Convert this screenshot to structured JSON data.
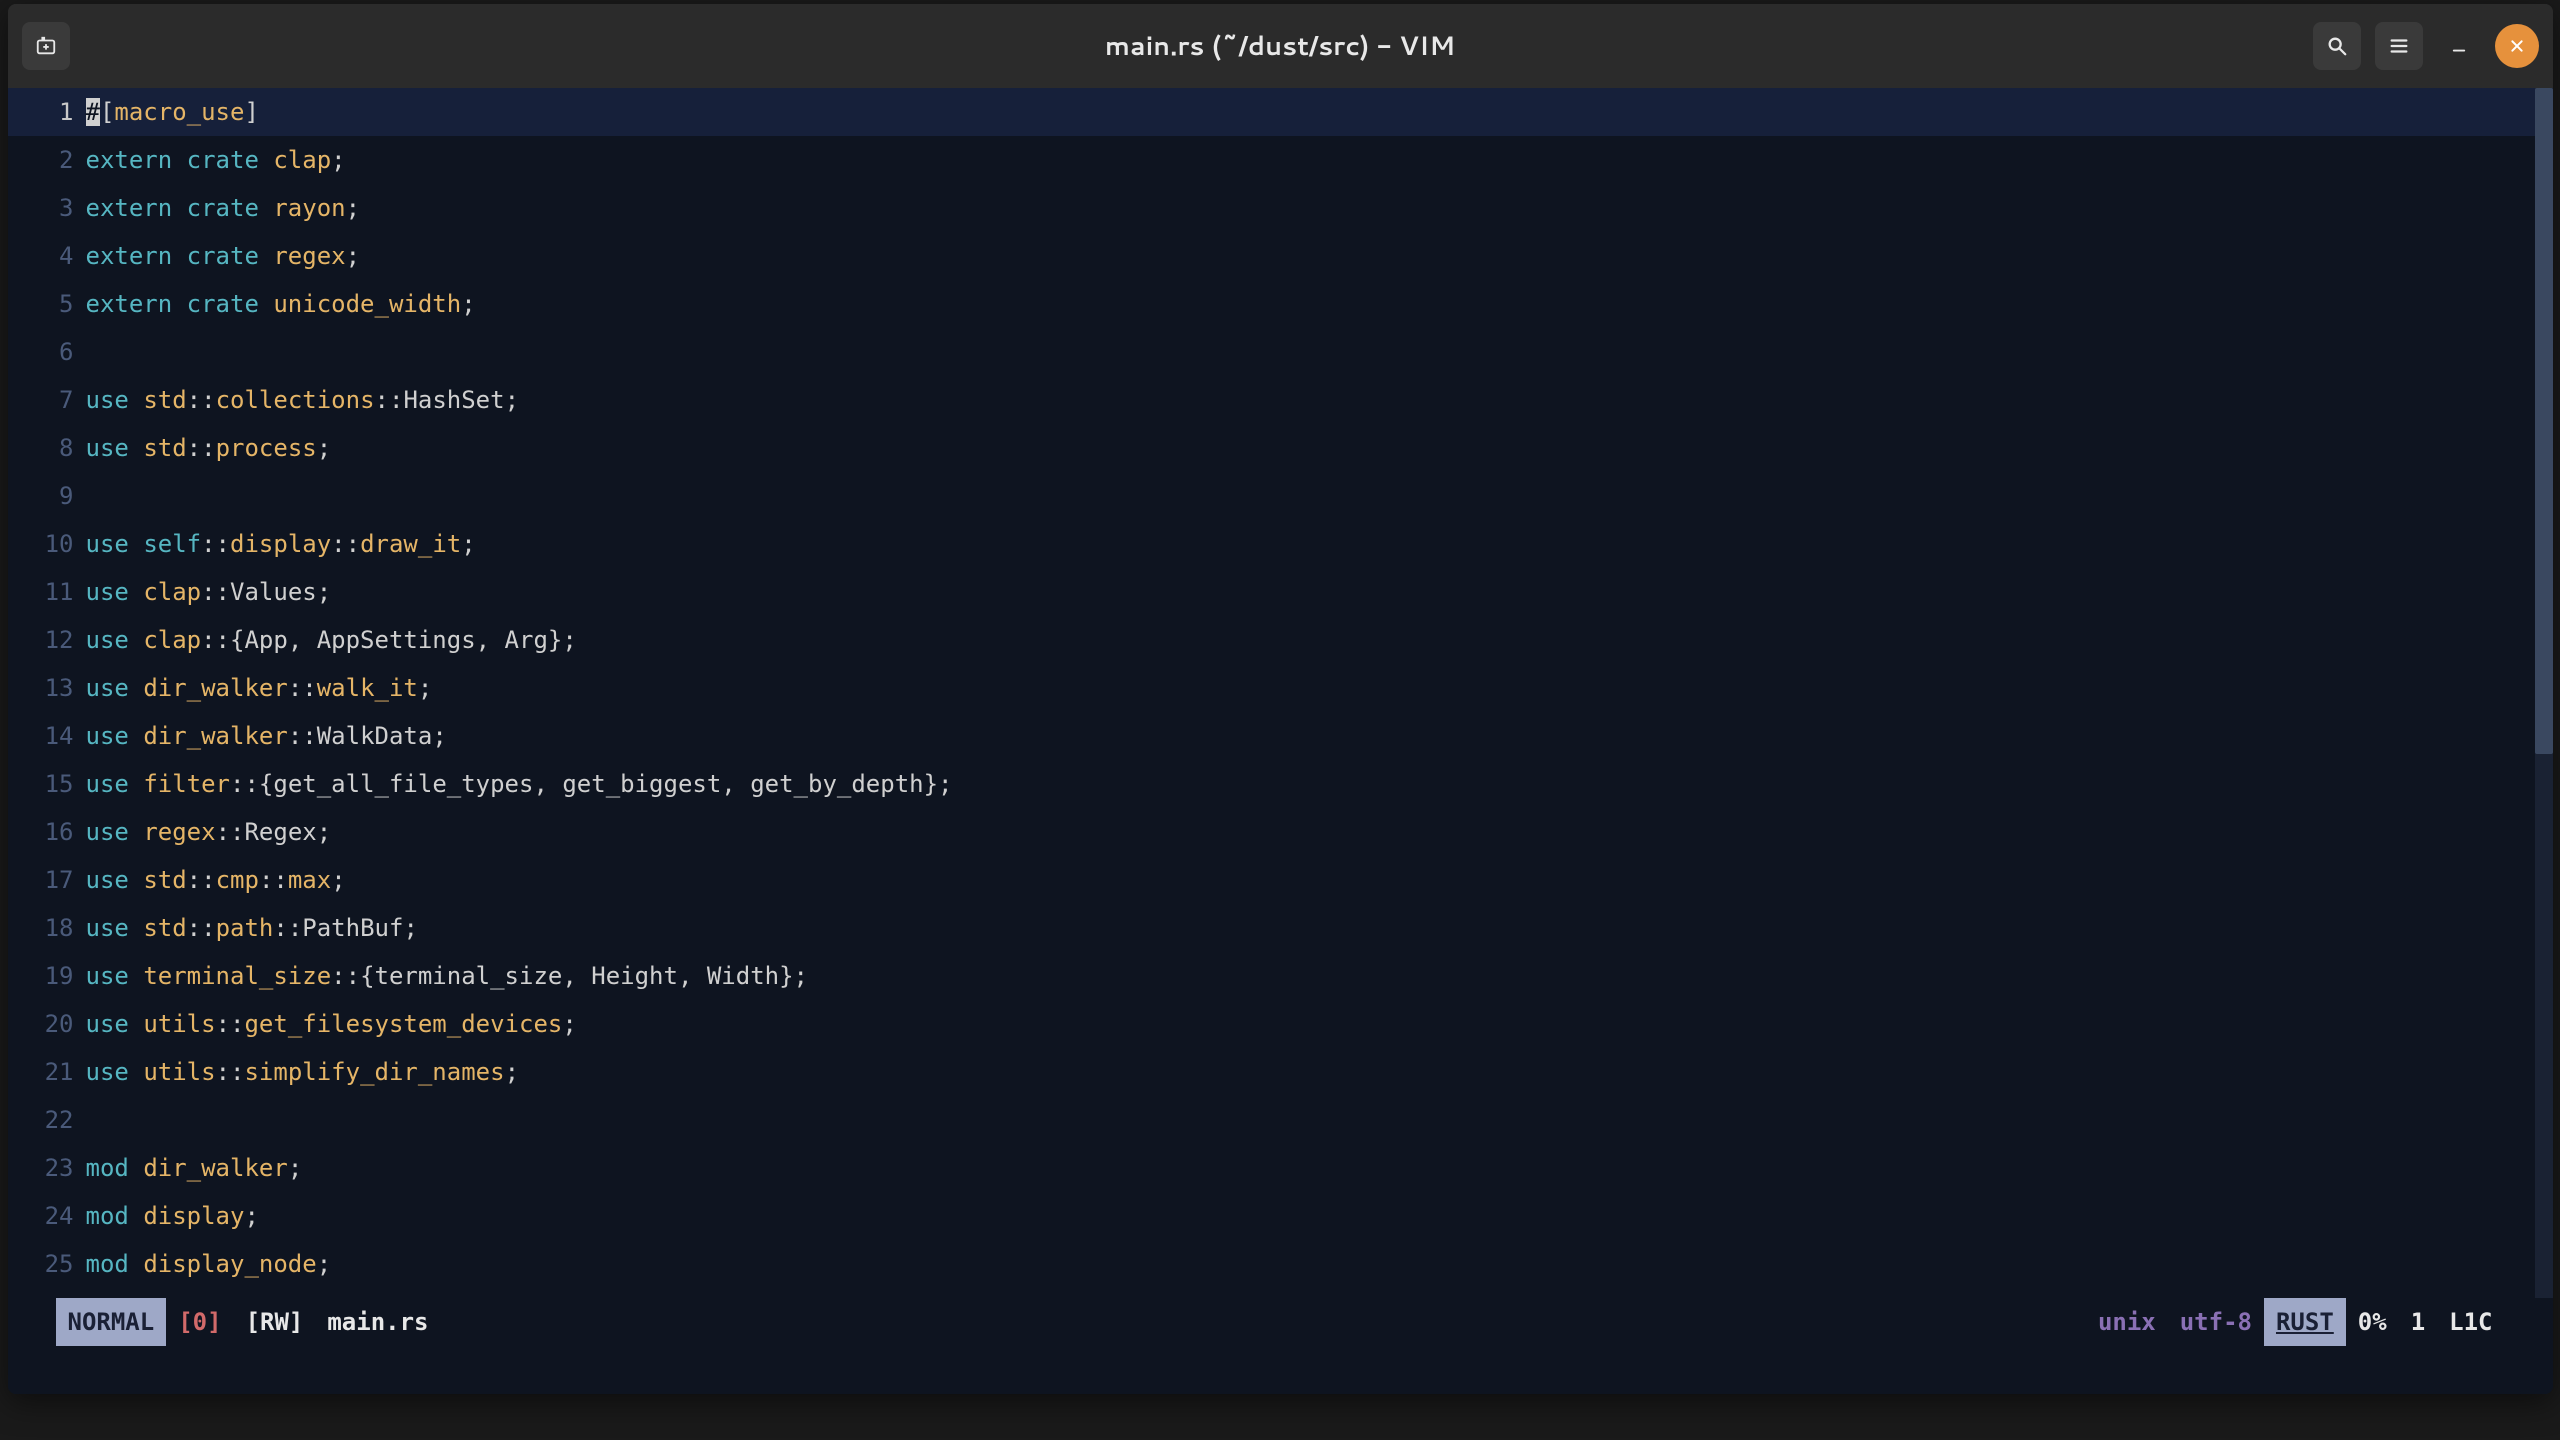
{
  "window": {
    "title": "main.rs (~/dust/src) - VIM"
  },
  "editor": {
    "cursor": {
      "line": 1,
      "col": 1,
      "char": "#"
    },
    "lines": [
      {
        "n": 1,
        "current": true,
        "tokens": [
          {
            "t": "#",
            "c": "cursor"
          },
          {
            "t": "[",
            "c": "attrb"
          },
          {
            "t": "macro_use",
            "c": "attrn"
          },
          {
            "t": "]",
            "c": "attrb"
          }
        ]
      },
      {
        "n": 2,
        "tokens": [
          {
            "t": "extern",
            "c": "kw"
          },
          {
            "t": " "
          },
          {
            "t": "crate",
            "c": "kw"
          },
          {
            "t": " "
          },
          {
            "t": "clap",
            "c": "ident"
          },
          {
            "t": ";",
            "c": "punc"
          }
        ]
      },
      {
        "n": 3,
        "tokens": [
          {
            "t": "extern",
            "c": "kw"
          },
          {
            "t": " "
          },
          {
            "t": "crate",
            "c": "kw"
          },
          {
            "t": " "
          },
          {
            "t": "rayon",
            "c": "ident"
          },
          {
            "t": ";",
            "c": "punc"
          }
        ]
      },
      {
        "n": 4,
        "tokens": [
          {
            "t": "extern",
            "c": "kw"
          },
          {
            "t": " "
          },
          {
            "t": "crate",
            "c": "kw"
          },
          {
            "t": " "
          },
          {
            "t": "regex",
            "c": "ident"
          },
          {
            "t": ";",
            "c": "punc"
          }
        ]
      },
      {
        "n": 5,
        "tokens": [
          {
            "t": "extern",
            "c": "kw"
          },
          {
            "t": " "
          },
          {
            "t": "crate",
            "c": "kw"
          },
          {
            "t": " "
          },
          {
            "t": "unicode_width",
            "c": "ident"
          },
          {
            "t": ";",
            "c": "punc"
          }
        ]
      },
      {
        "n": 6,
        "tokens": []
      },
      {
        "n": 7,
        "tokens": [
          {
            "t": "use",
            "c": "kw"
          },
          {
            "t": " "
          },
          {
            "t": "std",
            "c": "ident"
          },
          {
            "t": "::",
            "c": "punc"
          },
          {
            "t": "collections",
            "c": "ident"
          },
          {
            "t": "::",
            "c": "punc"
          },
          {
            "t": "HashSet",
            "c": "punc"
          },
          {
            "t": ";",
            "c": "punc"
          }
        ]
      },
      {
        "n": 8,
        "tokens": [
          {
            "t": "use",
            "c": "kw"
          },
          {
            "t": " "
          },
          {
            "t": "std",
            "c": "ident"
          },
          {
            "t": "::",
            "c": "punc"
          },
          {
            "t": "process",
            "c": "ident"
          },
          {
            "t": ";",
            "c": "punc"
          }
        ]
      },
      {
        "n": 9,
        "tokens": []
      },
      {
        "n": 10,
        "tokens": [
          {
            "t": "use",
            "c": "kw"
          },
          {
            "t": " "
          },
          {
            "t": "self",
            "c": "ns"
          },
          {
            "t": "::",
            "c": "punc"
          },
          {
            "t": "display",
            "c": "ident"
          },
          {
            "t": "::",
            "c": "punc"
          },
          {
            "t": "draw_it",
            "c": "ident"
          },
          {
            "t": ";",
            "c": "punc"
          }
        ]
      },
      {
        "n": 11,
        "tokens": [
          {
            "t": "use",
            "c": "kw"
          },
          {
            "t": " "
          },
          {
            "t": "clap",
            "c": "ident"
          },
          {
            "t": "::",
            "c": "punc"
          },
          {
            "t": "Values",
            "c": "punc"
          },
          {
            "t": ";",
            "c": "punc"
          }
        ]
      },
      {
        "n": 12,
        "tokens": [
          {
            "t": "use",
            "c": "kw"
          },
          {
            "t": " "
          },
          {
            "t": "clap",
            "c": "ident"
          },
          {
            "t": "::",
            "c": "punc"
          },
          {
            "t": "{App, AppSettings, Arg}",
            "c": "punc"
          },
          {
            "t": ";",
            "c": "punc"
          }
        ]
      },
      {
        "n": 13,
        "tokens": [
          {
            "t": "use",
            "c": "kw"
          },
          {
            "t": " "
          },
          {
            "t": "dir_walker",
            "c": "ident"
          },
          {
            "t": "::",
            "c": "punc"
          },
          {
            "t": "walk_it",
            "c": "ident"
          },
          {
            "t": ";",
            "c": "punc"
          }
        ]
      },
      {
        "n": 14,
        "tokens": [
          {
            "t": "use",
            "c": "kw"
          },
          {
            "t": " "
          },
          {
            "t": "dir_walker",
            "c": "ident"
          },
          {
            "t": "::",
            "c": "punc"
          },
          {
            "t": "WalkData",
            "c": "punc"
          },
          {
            "t": ";",
            "c": "punc"
          }
        ]
      },
      {
        "n": 15,
        "tokens": [
          {
            "t": "use",
            "c": "kw"
          },
          {
            "t": " "
          },
          {
            "t": "filter",
            "c": "ident"
          },
          {
            "t": "::",
            "c": "punc"
          },
          {
            "t": "{get_all_file_types, get_biggest, get_by_depth}",
            "c": "punc"
          },
          {
            "t": ";",
            "c": "punc"
          }
        ]
      },
      {
        "n": 16,
        "tokens": [
          {
            "t": "use",
            "c": "kw"
          },
          {
            "t": " "
          },
          {
            "t": "regex",
            "c": "ident"
          },
          {
            "t": "::",
            "c": "punc"
          },
          {
            "t": "Regex",
            "c": "punc"
          },
          {
            "t": ";",
            "c": "punc"
          }
        ]
      },
      {
        "n": 17,
        "tokens": [
          {
            "t": "use",
            "c": "kw"
          },
          {
            "t": " "
          },
          {
            "t": "std",
            "c": "ident"
          },
          {
            "t": "::",
            "c": "punc"
          },
          {
            "t": "cmp",
            "c": "ident"
          },
          {
            "t": "::",
            "c": "punc"
          },
          {
            "t": "max",
            "c": "ident"
          },
          {
            "t": ";",
            "c": "punc"
          }
        ]
      },
      {
        "n": 18,
        "tokens": [
          {
            "t": "use",
            "c": "kw"
          },
          {
            "t": " "
          },
          {
            "t": "std",
            "c": "ident"
          },
          {
            "t": "::",
            "c": "punc"
          },
          {
            "t": "path",
            "c": "ident"
          },
          {
            "t": "::",
            "c": "punc"
          },
          {
            "t": "PathBuf",
            "c": "punc"
          },
          {
            "t": ";",
            "c": "punc"
          }
        ]
      },
      {
        "n": 19,
        "tokens": [
          {
            "t": "use",
            "c": "kw"
          },
          {
            "t": " "
          },
          {
            "t": "terminal_size",
            "c": "ident"
          },
          {
            "t": "::",
            "c": "punc"
          },
          {
            "t": "{terminal_size, Height, Width}",
            "c": "punc"
          },
          {
            "t": ";",
            "c": "punc"
          }
        ]
      },
      {
        "n": 20,
        "tokens": [
          {
            "t": "use",
            "c": "kw"
          },
          {
            "t": " "
          },
          {
            "t": "utils",
            "c": "ident"
          },
          {
            "t": "::",
            "c": "punc"
          },
          {
            "t": "get_filesystem_devices",
            "c": "ident"
          },
          {
            "t": ";",
            "c": "punc"
          }
        ]
      },
      {
        "n": 21,
        "tokens": [
          {
            "t": "use",
            "c": "kw"
          },
          {
            "t": " "
          },
          {
            "t": "utils",
            "c": "ident"
          },
          {
            "t": "::",
            "c": "punc"
          },
          {
            "t": "simplify_dir_names",
            "c": "ident"
          },
          {
            "t": ";",
            "c": "punc"
          }
        ]
      },
      {
        "n": 22,
        "tokens": []
      },
      {
        "n": 23,
        "tokens": [
          {
            "t": "mod",
            "c": "kw"
          },
          {
            "t": " "
          },
          {
            "t": "dir_walker",
            "c": "ident"
          },
          {
            "t": ";",
            "c": "punc"
          }
        ]
      },
      {
        "n": 24,
        "tokens": [
          {
            "t": "mod",
            "c": "kw"
          },
          {
            "t": " "
          },
          {
            "t": "display",
            "c": "ident"
          },
          {
            "t": ";",
            "c": "punc"
          }
        ]
      },
      {
        "n": 25,
        "tokens": [
          {
            "t": "mod",
            "c": "kw"
          },
          {
            "t": " "
          },
          {
            "t": "display_node",
            "c": "ident"
          },
          {
            "t": ";",
            "c": "punc"
          }
        ]
      }
    ]
  },
  "status": {
    "mode": " NORMAL ",
    "modified": "[0]",
    "rw": "[RW]",
    "filename": "main.rs",
    "os": "unix",
    "encoding": "utf-8",
    "lang": " RUST ",
    "percent": "0%",
    "line": "1",
    "col": "L1C"
  }
}
